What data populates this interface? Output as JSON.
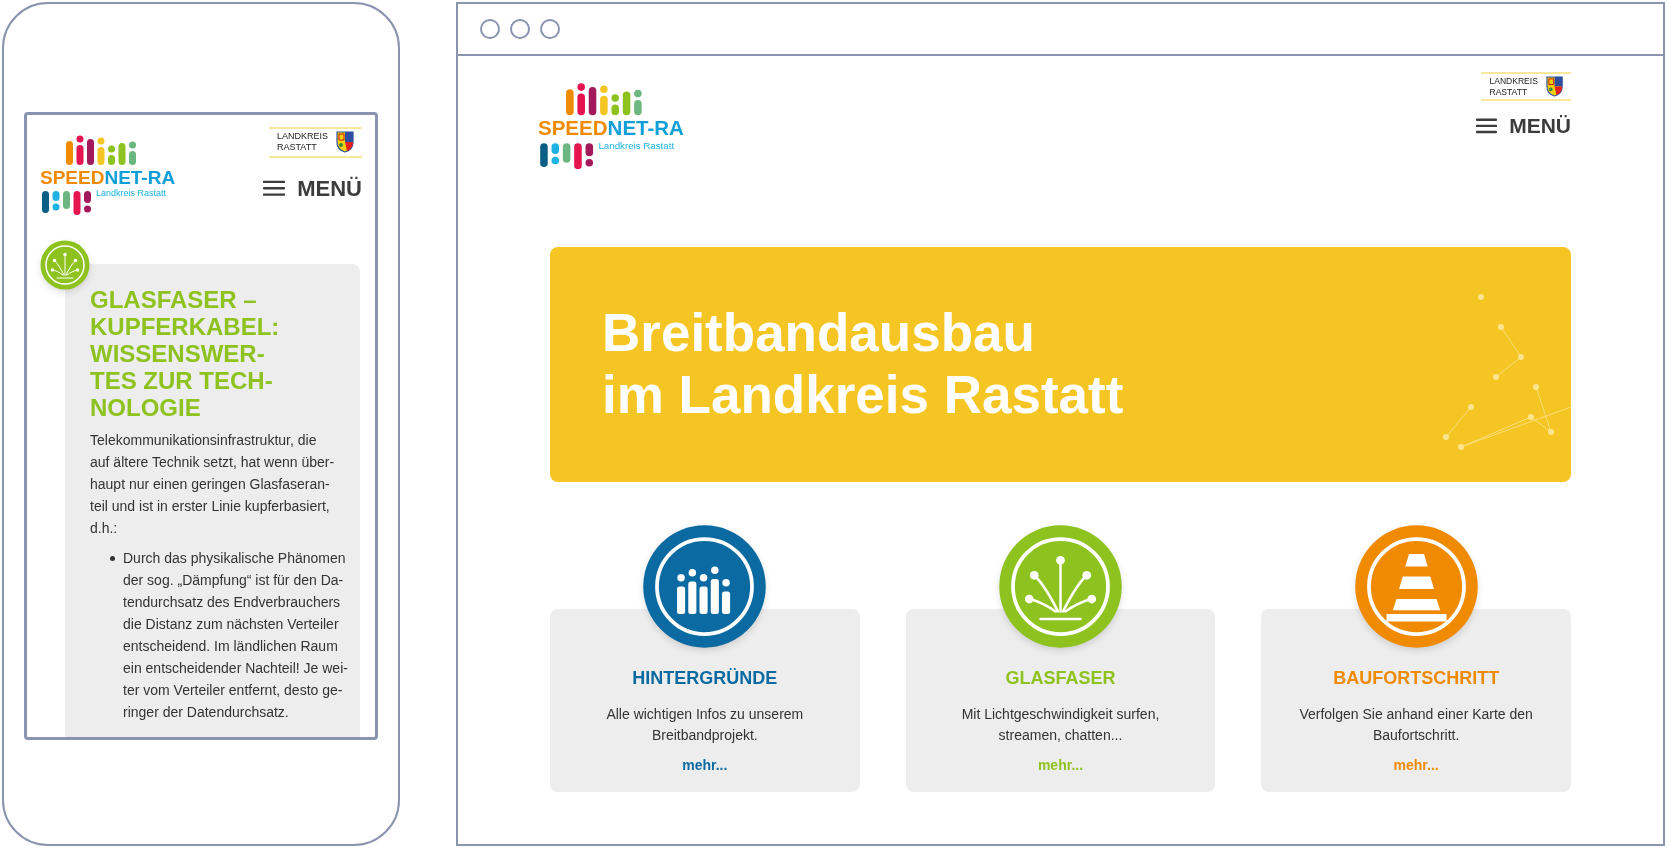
{
  "mobile_header": {
    "logo": {
      "part1": "SPEED",
      "part2": "NET-RA",
      "subtitle": "Landkreis Rastatt"
    },
    "district_badge": {
      "line1": "LANDKREIS",
      "line2": "RASTATT"
    },
    "menu_button": {
      "label": "MENÜ"
    }
  },
  "mobile_article": {
    "heading_lines": [
      "GLASFASER –",
      "KUPFERKABEL:",
      "WISSENSWER-",
      "TES ZUR TECH-",
      "NOLOGIE"
    ],
    "intro_lines": [
      "Telekommunikationsinfrastruktur, die",
      "auf ältere Technik setzt, hat wenn über-",
      "haupt nur einen geringen Glasfaseran-",
      "teil und ist in erster Linie kupferbasiert,",
      "d.h.:"
    ],
    "bullets": [
      {
        "lines": [
          "Durch das physikalische Phänomen",
          "der sog. „Dämpfung“ ist für den Da-",
          "tendurchsatz des Endverbrauchers",
          "die Distanz zum nächsten Verteiler",
          "entscheidend. Im ländlichen Raum",
          "ein entscheidender Nachteil! Je wei-",
          "ter vom Verteiler entfernt, desto ge-",
          "ringer der Datendurchsatz."
        ]
      }
    ]
  },
  "desktop_header": {
    "logo": {
      "part1": "SPEED",
      "part2": "NET-RA",
      "subtitle": "Landkreis Rastatt"
    },
    "district_badge": {
      "line1": "LANDKREIS",
      "line2": "RASTATT"
    },
    "menu_button": {
      "label": "MENÜ"
    }
  },
  "hero": {
    "title_lines": [
      "Breitbandausbau",
      "im Landkreis Rastatt"
    ]
  },
  "cards": [
    {
      "kind": "bars",
      "color": "#0a6aa1",
      "title": "HINTERGRÜNDE",
      "text_lines": [
        "Alle wichtigen Infos zu unserem",
        "Breitbandprojekt."
      ],
      "link": "mehr..."
    },
    {
      "kind": "fiber",
      "color": "#8dc21f",
      "title": "GLASFASER",
      "text_lines": [
        "Mit Lichtgeschwindigkeit surfen,",
        "streamen, chatten..."
      ],
      "link": "mehr..."
    },
    {
      "kind": "cone",
      "color": "#f08a00",
      "title": "BAUFORTSCHRITT",
      "text_lines": [
        "Verfolgen Sie anhand einer Karte den",
        "Baufortschritt."
      ],
      "link": "mehr..."
    }
  ]
}
